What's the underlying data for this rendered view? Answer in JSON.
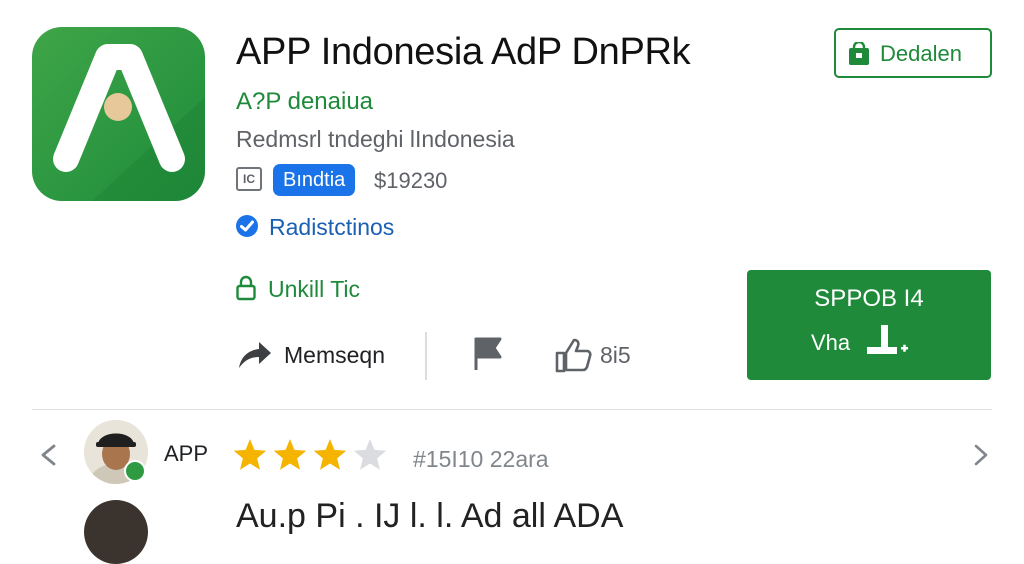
{
  "app": {
    "title": "APP Indonesia AdP DnPRk",
    "developer": "A?P denaiua",
    "subtitle": "Redmsrl tndeghi lIndonesia",
    "rating_badge": "IC",
    "category": "Bındtia",
    "price": "$19230",
    "verified": "Radistctinos",
    "permission": "Unkill Tic"
  },
  "actions": {
    "share_label": "Memseqn",
    "likes": "8i5"
  },
  "buttons": {
    "install_label": "Dedalen",
    "promo_title": "SPPOB I4",
    "promo_sub": "Vha"
  },
  "review": {
    "name": "APP",
    "rating": 3,
    "max_rating": 4,
    "meta": "#15I10 22ara",
    "next_text": "Au.p Pi  .  IJ  l. l.  Ad   all ADA"
  },
  "colors": {
    "brand_green": "#1e8a3a",
    "chip_blue": "#1a73e8",
    "star_gold": "#f4b400",
    "star_empty": "#dadce0"
  }
}
